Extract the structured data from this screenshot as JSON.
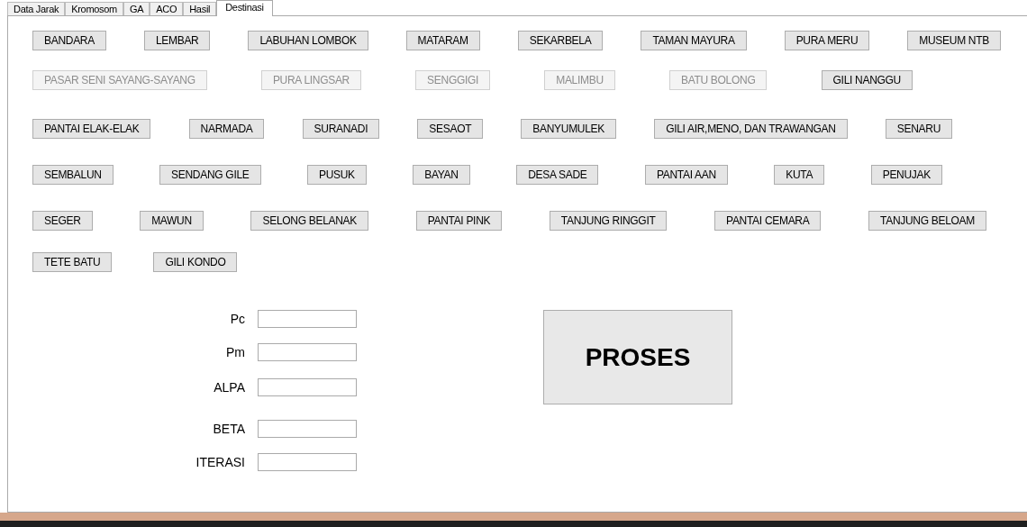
{
  "tabs": [
    {
      "label": "Data Jarak",
      "selected": false
    },
    {
      "label": "Kromosom",
      "selected": false
    },
    {
      "label": "GA",
      "selected": false
    },
    {
      "label": "ACO",
      "selected": false
    },
    {
      "label": "Hasil",
      "selected": false
    },
    {
      "label": "Destinasi",
      "selected": true
    }
  ],
  "destination_rows": [
    [
      {
        "label": "BANDARA",
        "disabled": false
      },
      {
        "label": "LEMBAR",
        "disabled": false
      },
      {
        "label": "LABUHAN LOMBOK",
        "disabled": false
      },
      {
        "label": "MATARAM",
        "disabled": false
      },
      {
        "label": "SEKARBELA",
        "disabled": false
      },
      {
        "label": "TAMAN MAYURA",
        "disabled": false
      },
      {
        "label": "PURA MERU",
        "disabled": false
      },
      {
        "label": "MUSEUM NTB",
        "disabled": false
      }
    ],
    [
      {
        "label": "PASAR SENI SAYANG-SAYANG",
        "disabled": true
      },
      {
        "label": "PURA LINGSAR",
        "disabled": true
      },
      {
        "label": "SENGGIGI",
        "disabled": true
      },
      {
        "label": "MALIMBU",
        "disabled": true
      },
      {
        "label": "BATU BOLONG",
        "disabled": true
      },
      {
        "label": "GILI NANGGU",
        "disabled": false
      }
    ],
    [
      {
        "label": "PANTAI ELAK-ELAK",
        "disabled": false
      },
      {
        "label": "NARMADA",
        "disabled": false
      },
      {
        "label": "SURANADI",
        "disabled": false
      },
      {
        "label": "SESAOT",
        "disabled": false
      },
      {
        "label": "BANYUMULEK",
        "disabled": false
      },
      {
        "label": "GILI AIR,MENO, DAN TRAWANGAN",
        "disabled": false
      },
      {
        "label": "SENARU",
        "disabled": false
      }
    ],
    [
      {
        "label": "SEMBALUN",
        "disabled": false
      },
      {
        "label": "SENDANG GILE",
        "disabled": false
      },
      {
        "label": "PUSUK",
        "disabled": false
      },
      {
        "label": "BAYAN",
        "disabled": false
      },
      {
        "label": "DESA SADE",
        "disabled": false
      },
      {
        "label": "PANTAI AAN",
        "disabled": false
      },
      {
        "label": "KUTA",
        "disabled": false
      },
      {
        "label": "PENUJAK",
        "disabled": false
      }
    ],
    [
      {
        "label": "SEGER",
        "disabled": false
      },
      {
        "label": "MAWUN",
        "disabled": false
      },
      {
        "label": "SELONG BELANAK",
        "disabled": false
      },
      {
        "label": "PANTAI PINK",
        "disabled": false
      },
      {
        "label": "TANJUNG RINGGIT",
        "disabled": false
      },
      {
        "label": "PANTAI CEMARA",
        "disabled": false
      },
      {
        "label": "TANJUNG BELOAM",
        "disabled": false
      }
    ],
    [
      {
        "label": "TETE BATU",
        "disabled": false
      },
      {
        "label": "GILI KONDO",
        "disabled": false
      }
    ]
  ],
  "parameters": [
    {
      "label": "Pc"
    },
    {
      "label": "Pm"
    },
    {
      "label": "ALPA"
    },
    {
      "label": "BETA"
    },
    {
      "label": "ITERASI"
    }
  ],
  "process_button": "PROSES"
}
